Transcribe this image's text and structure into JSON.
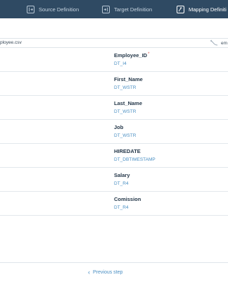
{
  "steps": [
    {
      "label": "Source Definition",
      "icon": "source-definition-icon",
      "active": false
    },
    {
      "label": "Target Definition",
      "icon": "target-definition-icon",
      "active": false
    },
    {
      "label": "Mapping Definiti",
      "icon": "mapping-definition-icon",
      "active": true
    }
  ],
  "file": {
    "name": "ployee.csv",
    "right_text": "em"
  },
  "fields": [
    {
      "name": "Employee_ID",
      "type": "DT_I4",
      "required": "*"
    },
    {
      "name": "First_Name",
      "type": "DT_WSTR",
      "required": ""
    },
    {
      "name": "Last_Name",
      "type": "DT_WSTR",
      "required": ""
    },
    {
      "name": "Job",
      "type": "DT_WSTR",
      "required": ""
    },
    {
      "name": "HIREDATE",
      "type": "DT_DBTIMESTAMP",
      "required": ""
    },
    {
      "name": "Salary",
      "type": "DT_R4",
      "required": ""
    },
    {
      "name": "Comission",
      "type": "DT_R4",
      "required": ""
    }
  ],
  "footer": {
    "previous_label": "Previous step"
  },
  "colors": {
    "topbar": "#2f4a63",
    "accent": "#4a8fc3",
    "required": "#e0544f"
  }
}
